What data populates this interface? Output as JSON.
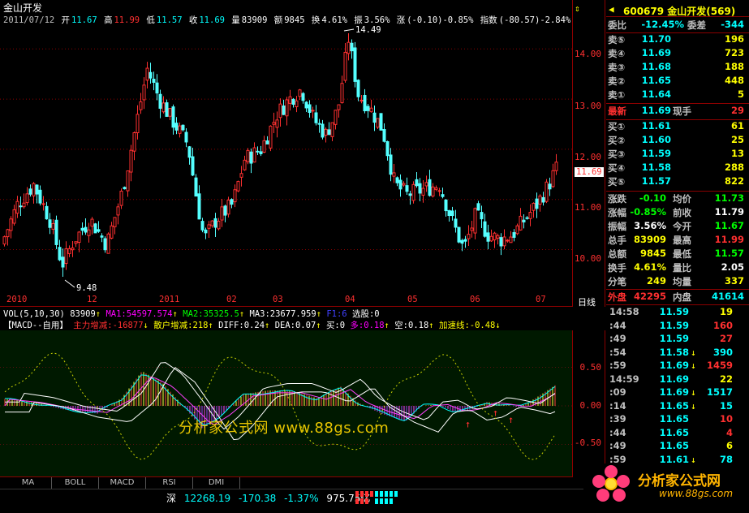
{
  "header": {
    "stock_name": "金山开发",
    "code_line": "600679 金山开发(569)"
  },
  "quote_line": {
    "date": "2011/07/12",
    "open_label": "开",
    "open": "11.67",
    "high_label": "高",
    "high": "11.99",
    "low_label": "低",
    "low": "11.57",
    "close_label": "收",
    "close": "11.69",
    "vol_label": "量",
    "vol": "83909",
    "amt_label": "额",
    "amt": "9845",
    "turnover_label": "换",
    "turnover": "4.61%",
    "amp_label": "振",
    "amp": "3.56%",
    "chg_label": "涨",
    "chg": "(-0.10)-0.85%",
    "idx_label": "指数",
    "idx": "(-80.57)-2.84%"
  },
  "price_axis": [
    "14.00",
    "13.00",
    "12.00",
    "11.00",
    "10.00"
  ],
  "current_price_tag": "11.69",
  "max_marker": "14.49",
  "min_marker": "9.48",
  "date_axis": [
    "2010",
    "12",
    "2011",
    "02",
    "03",
    "04",
    "05",
    "06",
    "07"
  ],
  "period_label": "日线",
  "vol_line": {
    "label": "VOL(5,10,30)",
    "vol": "83909",
    "ma1": "MA1:54597.574",
    "ma2": "MA2:35325.5",
    "ma3": "MA3:23677.959",
    "extra": "F1:6",
    "select": "选股:0"
  },
  "macd_line": {
    "name": "【MACD--自用】",
    "main_label": "主力增减:-16877",
    "retail_label": "散户增减:218",
    "diff": "DIFF:0.24",
    "dea": "DEA:0.07",
    "buy": "买:0",
    "long": "多:0.18",
    "short": "空:0.18",
    "accel": "加速线:-0.48"
  },
  "macd_axis": [
    "0.50",
    "0.00",
    "-0.50"
  ],
  "watermark": "分析家公式网 www.88gs.com",
  "tabs": [
    "MA",
    "BOLL",
    "MACD",
    "RSI",
    "DMI"
  ],
  "status": {
    "market": "深",
    "index": "12268.19",
    "change": "-170.38",
    "pct": "-1.37%",
    "amount": "975.75亿"
  },
  "side_panel": {
    "ratio_label": "委比",
    "ratio": "-12.45%",
    "diff_label": "委差",
    "diff": "-344",
    "asks": [
      {
        "label": "卖⑤",
        "price": "11.70",
        "vol": "196"
      },
      {
        "label": "卖④",
        "price": "11.69",
        "vol": "723"
      },
      {
        "label": "卖③",
        "price": "11.68",
        "vol": "188"
      },
      {
        "label": "卖②",
        "price": "11.65",
        "vol": "448"
      },
      {
        "label": "卖①",
        "price": "11.64",
        "vol": "5"
      }
    ],
    "last_label": "最新",
    "last": "11.69",
    "hand_label": "现手",
    "hand": "29",
    "bids": [
      {
        "label": "买①",
        "price": "11.61",
        "vol": "61"
      },
      {
        "label": "买②",
        "price": "11.60",
        "vol": "25"
      },
      {
        "label": "买③",
        "price": "11.59",
        "vol": "13"
      },
      {
        "label": "买④",
        "price": "11.58",
        "vol": "288"
      },
      {
        "label": "买⑤",
        "price": "11.57",
        "vol": "822"
      }
    ],
    "stats": [
      {
        "l1": "涨跌",
        "v1": "-0.10",
        "c1": "#00ff00",
        "l2": "均价",
        "v2": "11.73",
        "c2": "#00ff00"
      },
      {
        "l1": "涨幅",
        "v1": "-0.85%",
        "c1": "#00ff00",
        "l2": "前收",
        "v2": "11.79",
        "c2": "#ffffff"
      },
      {
        "l1": "振幅",
        "v1": "3.56%",
        "c1": "#ffffff",
        "l2": "今开",
        "v2": "11.67",
        "c2": "#00ff00"
      },
      {
        "l1": "总手",
        "v1": "83909",
        "c1": "#ffff00",
        "l2": "最高",
        "v2": "11.99",
        "c2": "#ff3030"
      },
      {
        "l1": "总额",
        "v1": "9845",
        "c1": "#ffff00",
        "l2": "最低",
        "v2": "11.57",
        "c2": "#00ff00"
      },
      {
        "l1": "换手",
        "v1": "4.61%",
        "c1": "#ffff00",
        "l2": "量比",
        "v2": "2.05",
        "c2": "#ffffff"
      },
      {
        "l1": "分笔",
        "v1": "249",
        "c1": "#ffff00",
        "l2": "均量",
        "v2": "337",
        "c2": "#ffff00"
      }
    ],
    "outer_label": "外盘",
    "outer": "42295",
    "inner_label": "内盘",
    "inner": "41614",
    "ticks": [
      {
        "t": "14:58",
        "p": "11.59",
        "v": "19",
        "vc": "#ffff00"
      },
      {
        "t": ":44",
        "p": "11.59",
        "v": "160",
        "vc": "#ff3030"
      },
      {
        "t": ":49",
        "p": "11.59",
        "v": "27",
        "vc": "#ff3030"
      },
      {
        "t": ":54",
        "p": "11.58",
        "v": "390",
        "vc": "#00ffff"
      },
      {
        "t": ":59",
        "p": "11.69",
        "v": "1459",
        "vc": "#ff3030"
      },
      {
        "t": "14:59",
        "p": "11.69",
        "v": "22",
        "vc": "#ffff00"
      },
      {
        "t": ":09",
        "p": "11.69",
        "v": "1517",
        "vc": "#00ffff"
      },
      {
        "t": ":14",
        "p": "11.65",
        "v": "15",
        "vc": "#00ffff"
      },
      {
        "t": ":39",
        "p": "11.65",
        "v": "10",
        "vc": "#ff3030"
      },
      {
        "t": ":44",
        "p": "11.65",
        "v": "4",
        "vc": "#ff3030"
      },
      {
        "t": ":49",
        "p": "11.65",
        "v": "6",
        "vc": "#ffff00"
      },
      {
        "t": ":59",
        "p": "11.61",
        "v": "78",
        "vc": "#00ffff"
      }
    ]
  },
  "logo": {
    "text": "分析家公式网",
    "url": "www.88gs.com"
  },
  "colors": {
    "up": "#ff3030",
    "down": "#54ffff",
    "grid": "#8b0000",
    "bg": "#000000"
  }
}
